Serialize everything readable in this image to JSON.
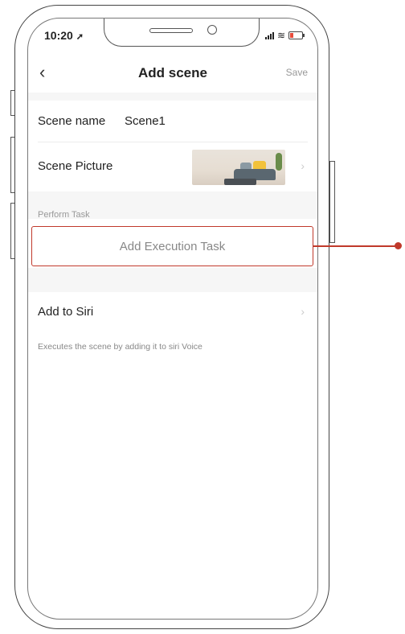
{
  "status_bar": {
    "time": "10:20",
    "location_icon": "location-arrow-icon",
    "signal_icon": "signal-icon",
    "wifi_icon": "wifi-icon",
    "battery_icon": "battery-icon"
  },
  "nav": {
    "back_icon": "chevron-left-icon",
    "title": "Add scene",
    "save_label": "Save"
  },
  "scene_name": {
    "label": "Scene name",
    "value": "Scene1"
  },
  "scene_picture": {
    "label": "Scene Picture",
    "thumbnail_icon": "living-room-thumbnail",
    "chevron_icon": "chevron-right-icon"
  },
  "perform_task": {
    "section_label": "Perform Task",
    "add_button_label": "Add Execution Task"
  },
  "siri": {
    "label": "Add to Siri",
    "chevron_icon": "chevron-right-icon",
    "description": "Executes the scene by adding it to siri Voice"
  },
  "colors": {
    "accent": "#c0392b",
    "muted_text": "#999999"
  }
}
